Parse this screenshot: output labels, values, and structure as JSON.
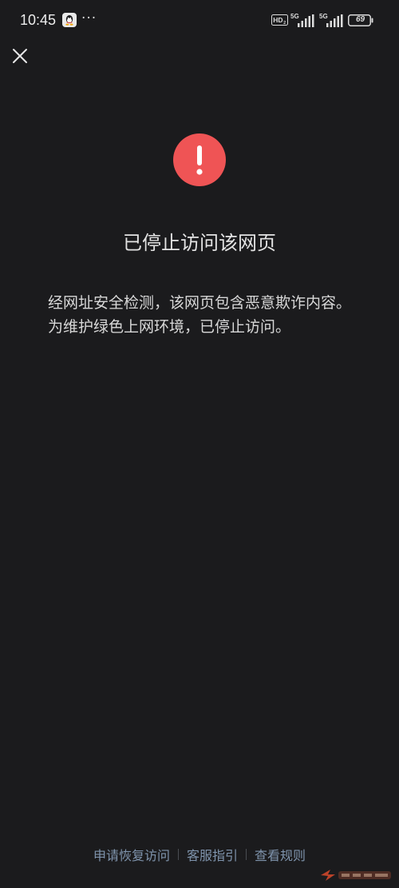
{
  "status_bar": {
    "time": "10:45",
    "more": "···",
    "network_1": "5G",
    "network_2": "5G",
    "battery": "69",
    "icons": [
      "qq-icon",
      "hd-icon",
      "signal-icon",
      "battery-icon"
    ]
  },
  "close_icon": "close-icon",
  "warning_icon": "exclamation-icon",
  "colors": {
    "background": "#1b1b1d",
    "warning": "#ef5455",
    "link": "#7f94ad"
  },
  "title": "已停止访问该网页",
  "message": "经网址安全检测，该网页包含恶意欺诈内容。为维护绿色上网环境，已停止访问。",
  "footer": {
    "links": [
      "申请恢复访问",
      "客服指引",
      "查看规则"
    ]
  }
}
